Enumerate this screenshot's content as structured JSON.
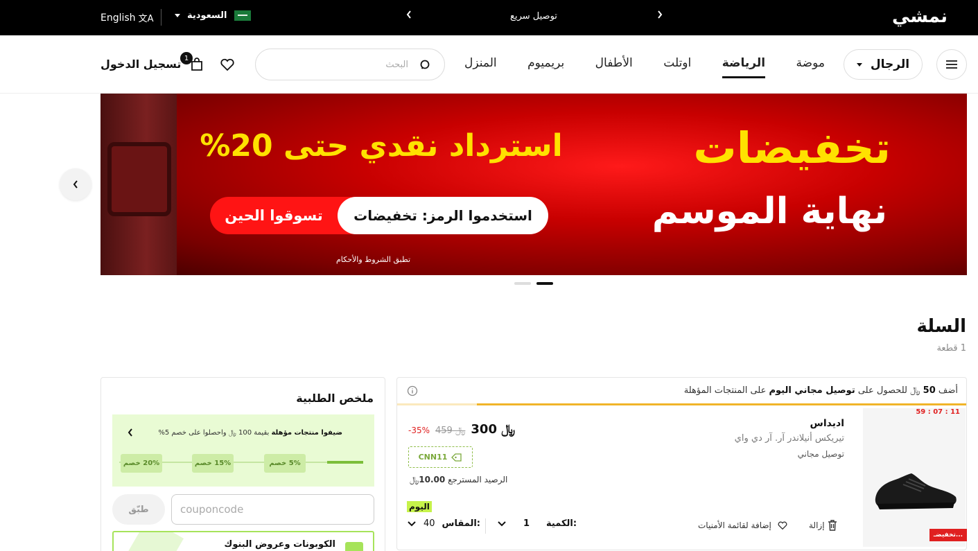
{
  "topbar": {
    "logo": "نمشي",
    "promo": "توصيل سريع",
    "language": "English",
    "country": "السعودية"
  },
  "nav": {
    "gender": "الرجال",
    "categories": [
      {
        "label": "موضة",
        "active": false
      },
      {
        "label": "الرياضة",
        "active": true
      },
      {
        "label": "اوتلت",
        "active": false
      },
      {
        "label": "الأطفال",
        "active": false
      },
      {
        "label": "بريميوم",
        "active": false
      },
      {
        "label": "المنزل",
        "active": false
      }
    ],
    "search_placeholder": "البحث",
    "bag_count": "1",
    "login": "تسجيل الدخول"
  },
  "banner": {
    "title": "تخفيضات",
    "subtitle": "نهاية الموسم",
    "headline": "استرداد نقدي حتى 20%",
    "code": "استخدموا الرمز: تخفيضات",
    "cta": "تسوقوا الحين",
    "terms": "تطبق الشروط والأحكام",
    "slide_count": 2,
    "active_slide": 2
  },
  "cart": {
    "title": "السلة",
    "count": "1 قطعة"
  },
  "summary": {
    "title": "ملخص الطلبية",
    "tier_message_prefix": "ضيفوا منتجات مؤهلة",
    "tier_message_rest": "بقيمة 100 ﷼ واحصلوا على خصم 5%",
    "tier_progress": 0.15,
    "tiers": [
      "5% خصم",
      "15% خصم",
      "20% خصم"
    ],
    "coupon_placeholder": "couponcode",
    "apply": "طبّق",
    "bank_offers": "الكوبونات وعروض البنوك"
  },
  "shipping": {
    "prefix": "أضف",
    "amount": "50",
    "currency": "﷼",
    "middle": "للحصول على",
    "highlight": "توصيل مجاني اليوم",
    "suffix": "على المنتجات المؤهلة",
    "progress": 0.86
  },
  "item": {
    "timer": "59 : 07 : 11",
    "sale_badge": "تخفيضـ...",
    "brand": "اديداس",
    "name": "تيريكس أنيلاندر آر. آر دي واي",
    "delivery": "توصيل مجاني",
    "price": "300",
    "old_price": "459",
    "discount": "-35%",
    "coupon": "CNN11",
    "cashback_label": "الرصيد المسترجع",
    "cashback_value": "10.00",
    "badge": "اليوم",
    "qty_label": "الكمية:",
    "qty": "1",
    "size_label": "المقاس:",
    "size": "40",
    "wishlist": "إضافة لقائمة الأمنيات",
    "remove": "إزالة"
  },
  "colors": {
    "accent": "#f0b429",
    "sale": "#e02020",
    "green": "#a6e35a"
  }
}
